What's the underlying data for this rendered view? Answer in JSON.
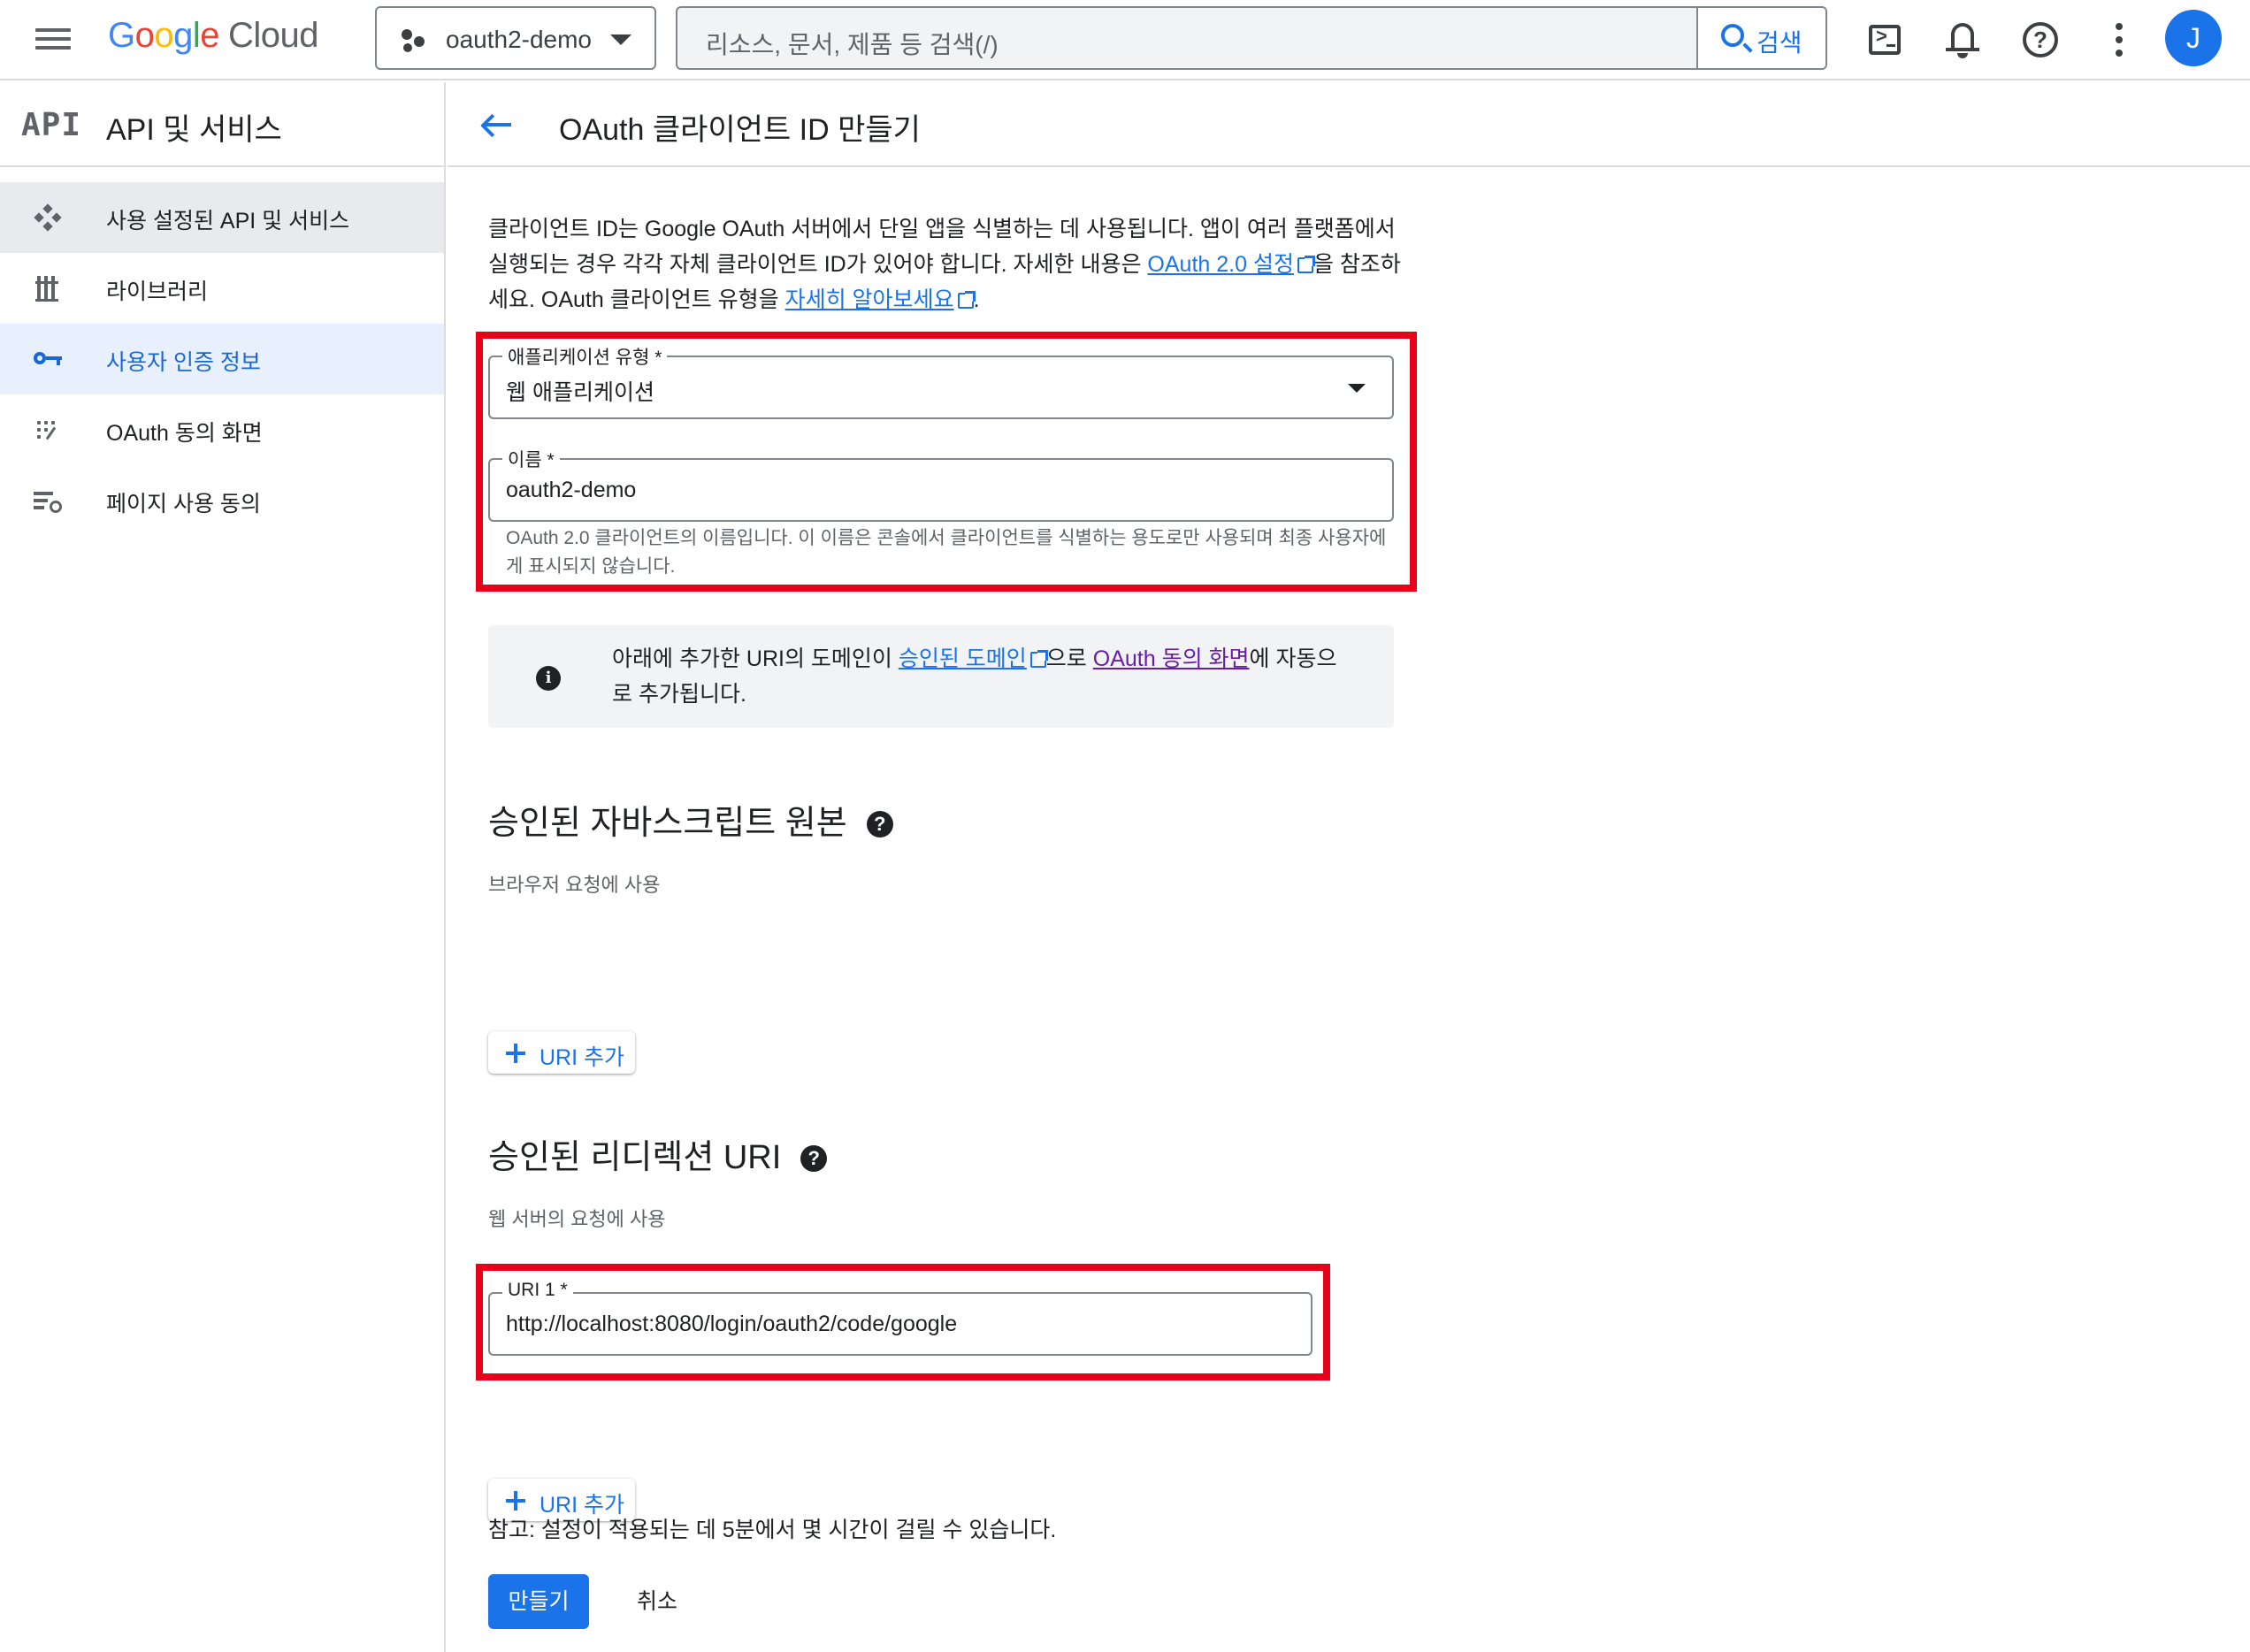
{
  "header": {
    "logo_google": "Google",
    "logo_cloud": "Cloud",
    "project_name": "oauth2-demo",
    "search_placeholder": "리소스, 문서, 제품 등 검색(/)",
    "search_button": "검색",
    "avatar_initial": "J"
  },
  "sidebar": {
    "logo_text": "API",
    "title": "API 및 서비스",
    "items": [
      {
        "label": "사용 설정된 API 및 서비스",
        "icon": "enabled-apis-icon",
        "state": "hover"
      },
      {
        "label": "라이브러리",
        "icon": "library-icon",
        "state": "normal"
      },
      {
        "label": "사용자 인증 정보",
        "icon": "key-icon",
        "state": "active"
      },
      {
        "label": "OAuth 동의 화면",
        "icon": "consent-screen-icon",
        "state": "normal"
      },
      {
        "label": "페이지 사용 동의",
        "icon": "page-usage-agreement-icon",
        "state": "normal"
      }
    ]
  },
  "main": {
    "page_title": "OAuth 클라이언트 ID 만들기",
    "intro": {
      "text1": "클라이언트 ID는 Google OAuth 서버에서 단일 앱을 식별하는 데 사용됩니다. 앱이 여러 플랫폼에서 실행되는 경우 각각 자체 클라이언트 ID가 있어야 합니다. 자세한 내용은 ",
      "link1": "OAuth 2.0 설정",
      "text2": "을 참조하세요. OAuth 클라이언트 유형을 ",
      "link2": "자세히 알아보세요",
      "text3": "."
    },
    "app_type": {
      "label": "애플리케이션 유형 *",
      "value": "웹 애플리케이션"
    },
    "name": {
      "label": "이름 *",
      "value": "oauth2-demo",
      "helper": "OAuth 2.0 클라이언트의 이름입니다. 이 이름은 콘솔에서 클라이언트를 식별하는 용도로만 사용되며 최종 사용자에게 표시되지 않습니다."
    },
    "info": {
      "text1": "아래에 추가한 URI의 도메인이 ",
      "link1": "승인된 도메인",
      "text2": "으로 ",
      "link2": "OAuth 동의 화면",
      "text3": "에 자동으로 추가됩니다."
    },
    "js_origins": {
      "title": "승인된 자바스크립트 원본",
      "subtitle": "브라우저 요청에 사용",
      "add_button": "URI 추가"
    },
    "redirect_uris": {
      "title": "승인된 리디렉션 URI",
      "subtitle": "웹 서버의 요청에 사용",
      "uri1_label": "URI 1 *",
      "uri1_value": "http://localhost:8080/login/oauth2/code/google",
      "add_button": "URI 추가"
    },
    "note": "참고: 설정이 적용되는 데 5분에서 몇 시간이 걸릴 수 있습니다.",
    "create_button": "만들기",
    "cancel_button": "취소"
  },
  "colors": {
    "accent": "#1a73e8",
    "highlight_box": "#e6001a",
    "active_nav_bg": "#e8f0fe",
    "visited_link": "#681da8"
  }
}
